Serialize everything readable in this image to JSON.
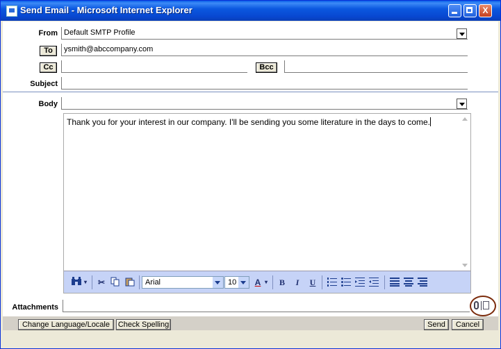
{
  "window": {
    "title": "Send Email - Microsoft Internet Explorer",
    "minimize_icon": "minimize-icon",
    "maximize_icon": "maximize-icon",
    "close_glyph": "X"
  },
  "form": {
    "from_label": "From",
    "from_value": "Default SMTP Profile",
    "to_button": "To",
    "to_value": "ysmith@abccompany.com",
    "cc_button": "Cc",
    "cc_value": "",
    "bcc_button": "Bcc",
    "bcc_value": "",
    "subject_label": "Subject",
    "subject_value": "",
    "body_label": "Body",
    "body_template_value": "",
    "attachments_label": "Attachments",
    "attachments_value": ""
  },
  "editor": {
    "text": "Thank you for your interest in our company. I'll be sending you some literature in the days to come."
  },
  "toolbar": {
    "find_icon": "binoculars-icon",
    "cut_icon": "scissors-icon",
    "copy_icon": "copy-icon",
    "paste_icon": "paste-icon",
    "font_family": "Arial",
    "font_size": "10",
    "font_color_glyph": "A",
    "bold": "B",
    "italic": "I",
    "underline": "U",
    "ordered_list_icon": "ordered-list-icon",
    "unordered_list_icon": "unordered-list-icon",
    "indent_icon": "indent-icon",
    "outdent_icon": "outdent-icon",
    "align_left_icon": "align-left-icon",
    "align_center_icon": "align-center-icon",
    "align_right_icon": "align-right-icon"
  },
  "footer": {
    "change_language": "Change Language/Locale",
    "check_spelling": "Check Spelling",
    "send": "Send",
    "cancel": "Cancel"
  },
  "colors": {
    "title_bar": "#0a5ee8",
    "toolbar_bg": "#c6d3f7",
    "annotation_circle": "#7b2b0b"
  }
}
